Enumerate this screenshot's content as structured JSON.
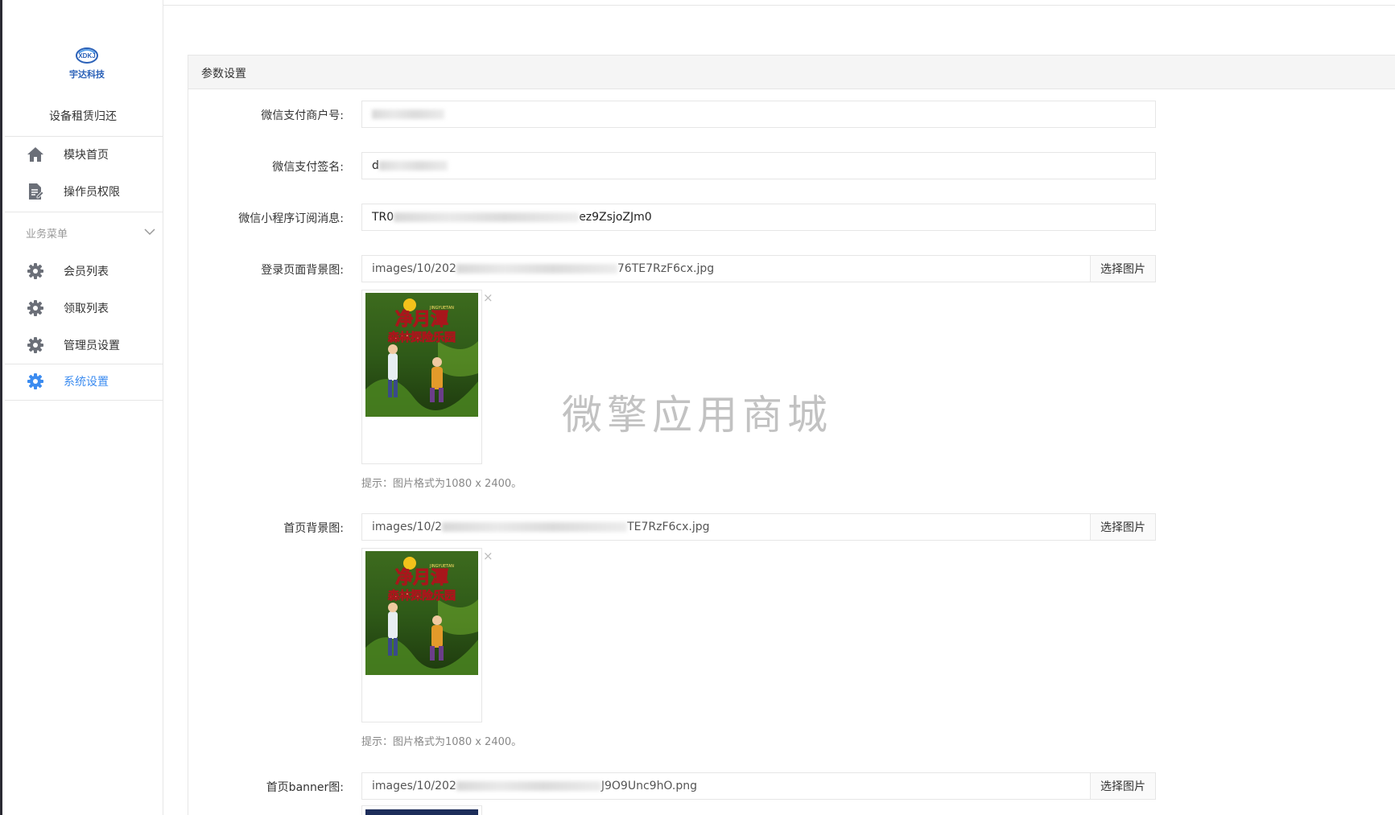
{
  "sidebar": {
    "logo_text": "宇达科技",
    "logo_mark": "XDKJ",
    "app_name": "设备租赁归还",
    "top_items": [
      {
        "label": "模块首页",
        "icon": "home-icon"
      },
      {
        "label": "操作员权限",
        "icon": "document-edit-icon"
      }
    ],
    "group_title": "业务菜单",
    "group_items": [
      {
        "label": "会员列表",
        "icon": "gear-icon"
      },
      {
        "label": "领取列表",
        "icon": "gear-icon"
      },
      {
        "label": "管理员设置",
        "icon": "gear-icon"
      },
      {
        "label": "系统设置",
        "icon": "gear-icon",
        "active": true
      }
    ],
    "active_color": "#3c8cf0"
  },
  "panel": {
    "title": "参数设置"
  },
  "form": {
    "merchant_id": {
      "label": "微信支付商户号:",
      "value": ""
    },
    "pay_sign": {
      "label": "微信支付签名:",
      "value_prefix": "d"
    },
    "subscribe_msg": {
      "label": "微信小程序订阅消息:",
      "value_prefix": "TR0",
      "value_suffix": "ez9ZsjoZJm0"
    },
    "login_bg": {
      "label": "登录页面背景图:",
      "value_prefix": "images/10/202",
      "value_suffix": "76TE7RzF6cx.jpg",
      "button": "选择图片",
      "hint": "提示：图片格式为1080 x 2400。"
    },
    "home_bg": {
      "label": "首页背景图:",
      "value_prefix": "images/10/2",
      "value_suffix": "TE7RzF6cx.jpg",
      "button": "选择图片",
      "hint": "提示：图片格式为1080 x 2400。"
    },
    "home_banner": {
      "label": "首页banner图:",
      "value_prefix": "images/10/202",
      "value_suffix": "J9O9Unc9hO.png",
      "button": "选择图片"
    }
  },
  "poster": {
    "title_line1": "净月潭",
    "title_line2": "森林探险乐园",
    "subtitle": "JINGYUETAN"
  },
  "watermark": "微擎应用商城",
  "close_symbol": "×"
}
